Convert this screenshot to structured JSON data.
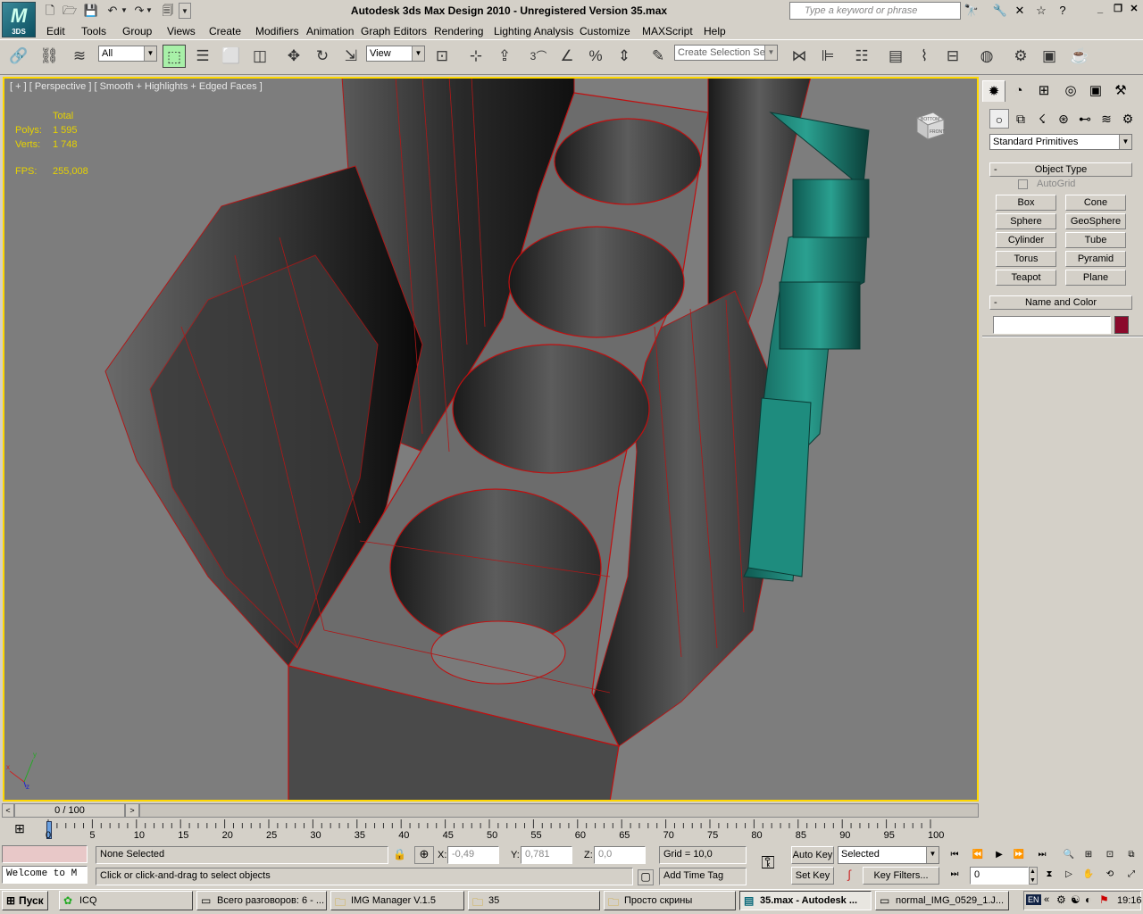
{
  "app": {
    "logo_text": "3DS",
    "title": "Autodesk 3ds Max Design 2010  - Unregistered Version    35.max",
    "search_placeholder": "Type a keyword or phrase"
  },
  "menu": [
    "Edit",
    "Tools",
    "Group",
    "Views",
    "Create",
    "Modifiers",
    "Animation",
    "Graph Editors",
    "Rendering",
    "Lighting Analysis",
    "Customize",
    "MAXScript",
    "Help"
  ],
  "toolbar": {
    "selection_filter": "All",
    "reference_coord": "View",
    "named_selection": "Create Selection Se"
  },
  "viewport": {
    "label": "[ + ] [ Perspective ] [ Smooth + Highlights + Edged Faces ]",
    "stats_header": "Total",
    "polys_label": "Polys:",
    "polys_value": "1 595",
    "verts_label": "Verts:",
    "verts_value": "1 748",
    "fps_label": "FPS:",
    "fps_value": "255,008",
    "viewcube_top": "BOTTOM",
    "viewcube_front": "FRONT",
    "axis_x": "x",
    "axis_y": "y",
    "axis_z": "z"
  },
  "command_panel": {
    "category": "Standard Primitives",
    "object_type_title": "Object Type",
    "autogrid": "AutoGrid",
    "primitives": [
      "Box",
      "Cone",
      "Sphere",
      "GeoSphere",
      "Cylinder",
      "Tube",
      "Torus",
      "Pyramid",
      "Teapot",
      "Plane"
    ],
    "name_color_title": "Name and Color",
    "name_value": "",
    "color": "#8b0a2c"
  },
  "timeline": {
    "frame_display": "0 / 100",
    "ticks": [
      "0",
      "5",
      "10",
      "15",
      "20",
      "25",
      "30",
      "35",
      "40",
      "45",
      "50",
      "55",
      "60",
      "65",
      "70",
      "75",
      "80",
      "85",
      "90",
      "95",
      "100"
    ]
  },
  "status": {
    "maxscript_listener": "Welcome to M",
    "selection": "None Selected",
    "prompt": "Click or click-and-drag to select objects",
    "x_label": "X:",
    "x_value": "-0,49",
    "y_label": "Y:",
    "y_value": "0,781",
    "z_label": "Z:",
    "z_value": "0,0",
    "grid": "Grid = 10,0",
    "add_time_tag": "Add Time Tag",
    "auto_key": "Auto Key",
    "set_key": "Set Key",
    "key_mode": "Selected",
    "key_filters": "Key Filters...",
    "current_frame": "0"
  },
  "taskbar": {
    "start": "Пуск",
    "tasks": [
      "ICQ",
      "Всего разговоров: 6 - ...",
      "IMG Manager V.1.5",
      "35",
      "Просто скрины",
      "35.max - Autodesk ...",
      "normal_IMG_0529_1.J..."
    ],
    "lang": "EN",
    "clock": "19:16"
  },
  "colors": {
    "viewport_bg": "#7d7d7d",
    "viewport_border": "#ffd800",
    "stats_text": "#e6d200",
    "wire": "#c01010",
    "teal_object": "#1e8c7e"
  }
}
